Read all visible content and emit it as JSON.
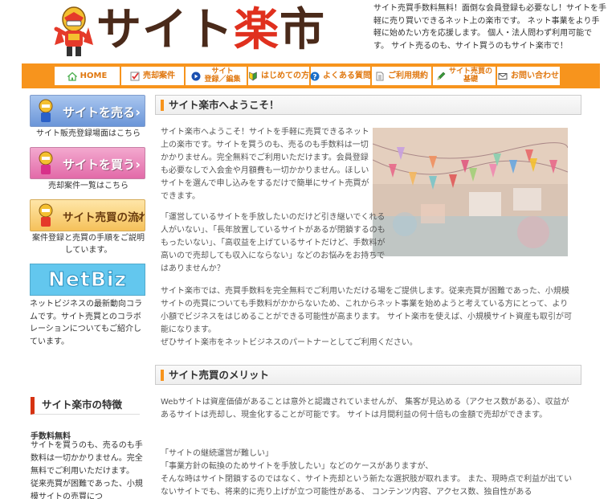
{
  "header": {
    "logo_parts": [
      "サイト",
      "楽",
      "市"
    ],
    "intro": "サイト売買手数料無料！面倒な会員登録も必要なし！サイトを手軽に売り買いできるネット上の楽市です。 ネット事業をより手軽に始めたい方を応援します。 個人・法人問わず利用可能です。 サイト売るのも、サイト買うのもサイト楽市で！"
  },
  "nav": {
    "items": [
      {
        "label": "HOME",
        "icon": "home-icon",
        "icon_color": "#4caf50"
      },
      {
        "label": "売却案件",
        "icon": "checklist-icon",
        "icon_color": "#d33"
      },
      {
        "label": "サイト登録／編集",
        "line1": "サイト",
        "line2": "登録／編集",
        "icon": "play-circle-icon",
        "icon_color": "#1a4fb0"
      },
      {
        "label": "はじめての方",
        "icon": "beginner-mark-icon",
        "icon_color": "#3a9b3a"
      },
      {
        "label": "よくある質問",
        "icon": "question-icon",
        "icon_color": "#1a6fc9"
      },
      {
        "label": "ご利用規約",
        "icon": "document-icon",
        "icon_color": "#888"
      },
      {
        "label": "サイト売買の基礎",
        "line1": "サイト売買の",
        "line2": "基礎",
        "icon": "pencil-icon",
        "icon_color": "#3a9b3a"
      },
      {
        "label": "お問い合わせ",
        "icon": "mail-icon",
        "icon_color": "#555"
      }
    ]
  },
  "sidebar": {
    "sell": {
      "label": "サイトを売る",
      "caption": "サイト販売登録場面はこちら"
    },
    "buy": {
      "label": "サイトを買う",
      "caption": "売却案件一覧はこちら"
    },
    "flow": {
      "label": "サイト売買の流れ",
      "caption": "案件登録と売買の手順をご説明しています。"
    },
    "netbiz": {
      "label": "NetBiz",
      "caption": "ネットビジネスの最新動向コラムです。サイト売買とのコラボレーションについてもご紹介しています。"
    },
    "feature": {
      "title": "サイト楽市の特徴",
      "heading": "手数料無料",
      "body": "サイトを買うのも、売るのも手数料は一切かかりません。完全無料でご利用いただけます。 従来売買が困難であった、小規模サイトの売買につ"
    }
  },
  "main": {
    "section1_title": "サイト楽市へようこそ！",
    "p1": "サイト楽市へようこそ！サイトを手軽に売買できるネット上の楽市です。サイトを買うのも、売るのも手数料は一切かかりません。完全無料でご利用いただけます。会員登録も必要なしで入会金や月額費も一切かかりません。ほしいサイトを選んで申し込みをするだけで簡単にサイト売買ができます。",
    "p2": "「運営しているサイトを手放したいのだけど引き継いでくれる人がいない」、「長年放置しているサイトがあるが閉鎖するのももったいない」、「高収益を上げているサイトだけど、手数料が高いので売却しても収入にならない」などのお悩みをお持ちではありませんか？",
    "p3": "サイト楽市では、売買手数料を完全無料でご利用いただける場をご提供します。従来売買が困難であった、小規模サイトの売買についても手数料がかからないため、これからネット事業を始めようと考えている方にとって、より小額でビジネスをはじめることができる可能性が高まります。 サイト楽市を使えば、小規模サイト資産も取引が可能になります。\nぜひサイト楽市をネットビジネスのパートナーとしてご利用ください。",
    "section2_title": "サイト売買のメリット",
    "p4": "Webサイトは資産価値があることは意外と認識されていませんが、 集客が見込める（アクセス数がある）、収益があるサイトは売却し、現金化することが可能です。 サイトは月間利益の何十倍もの金額で売却ができます。",
    "p5": "「サイトの継続運営が難しい」\n「事業方針の転換のためサイトを手放したい」などのケースがありますが、\nそんな時はサイト閉鎖するのではなく、サイト売却という新たな選択肢が取れます。 また、現時点で利益が出ていないサイトでも、将来的に売り上げが立つ可能性がある、 コンテンツ内容、アクセス数、独自性がある"
  }
}
